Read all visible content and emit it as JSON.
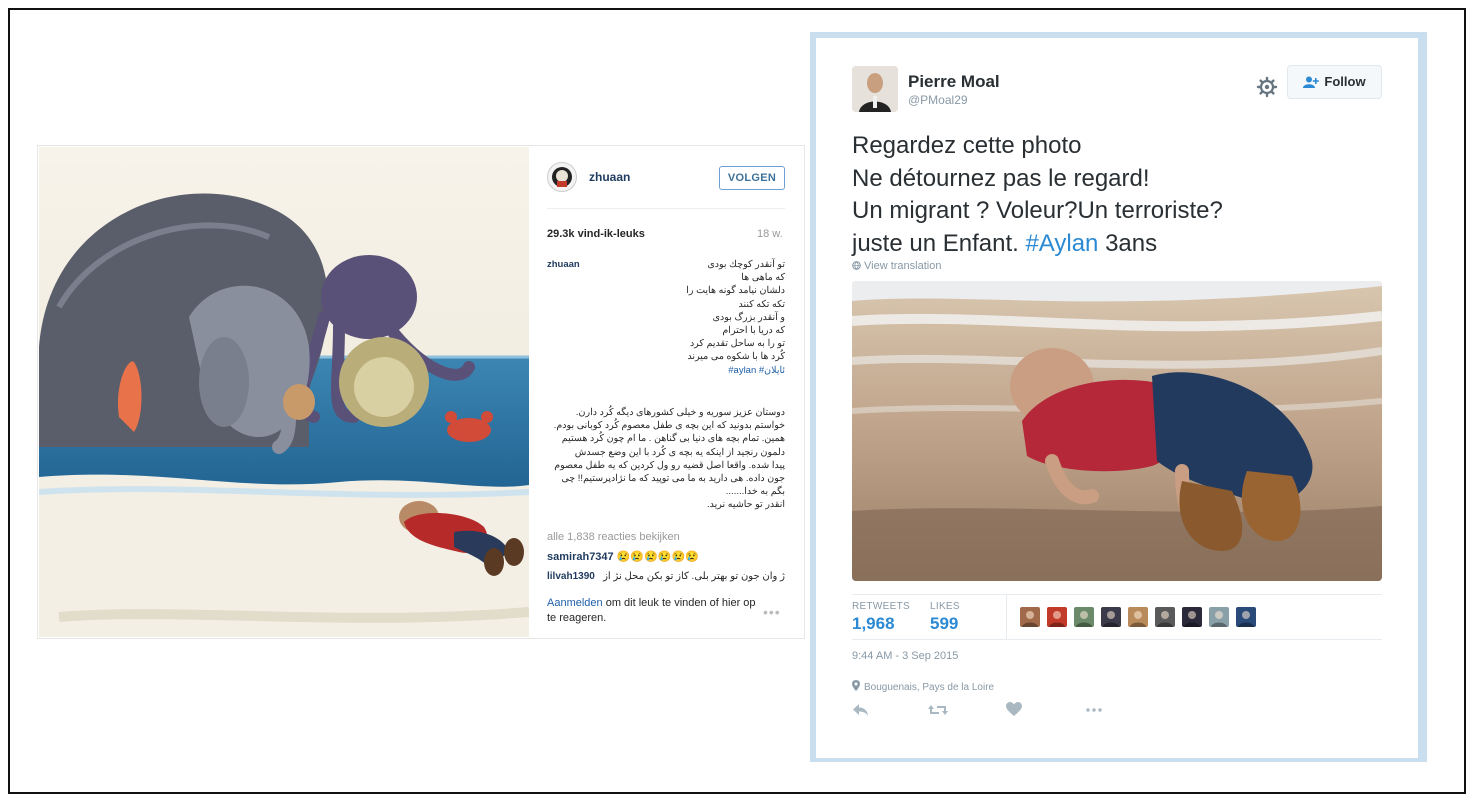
{
  "instagram": {
    "username": "zhuaan",
    "follow_label": "VOLGEN",
    "likes": "29.3k vind-ik-leuks",
    "time_ago": "18 w.",
    "caption_user": "zhuaan",
    "caption_lines": [
      "تو آنقدر کوچك بودی",
      "که ماهی ها",
      "دلشان نیامد گونه هایت را",
      "تکه تکه کنند",
      "و آنقدر بزرگ بودی",
      "که دریا با احترام",
      "تو را به ساحل تقدیم کرد",
      "کُرد ها با شکوه می میرند"
    ],
    "hashtags": "#aylan #ئايلان",
    "body_lines": [
      "دوستان عزیز سوریه و خیلی کشورهای دیگه کُرد دارن.",
      "خواستم بدونید که این بچه ی طفل معصوم کُرد کوبانی بودم.",
      "همین. تمام بچه های دنیا بی گناهن . ما ام چون کُرد هستیم",
      "دلمون رنجید از اینکه یه بچه ی کُرد با این وضع جسدش",
      "پیدا شده. واقعا اصل قضیه رو ول کردین که یه طفل معصوم",
      "جون داده. هی داريد به ما می توپيد كه ما نژادپرستيم!! چی",
      "بگم به خدا.......",
      "انقدر تو حاشیه نرید."
    ],
    "all_comments": "alle 1,838 reacties bekijken",
    "comment1_user": "samirah7347",
    "comment1_text": "😢😢😢😢😢😢",
    "comment2_user": "lilvah1390",
    "comment2_text": "ژ وان جون تو بهتر بلی. کاز تو بکن محل نژ از",
    "login_link": "Aanmelden",
    "login_text": " om dit leuk te vinden of hier op te reageren.",
    "more_label": "•••"
  },
  "twitter": {
    "name": "Pierre Moal",
    "handle": "@PMoal29",
    "follow_label": "Follow",
    "line1": "Regardez cette photo",
    "line2": "Ne détournez pas le regard!",
    "line3": "Un migrant ? Voleur?Un terroriste?",
    "line4_pre": "juste un Enfant. ",
    "line4_tag": "#Aylan",
    "line4_post": " 3ans",
    "view_translation": "View translation",
    "retweets_label": "RETWEETS",
    "retweets_value": "1,968",
    "likes_label": "LIKES",
    "likes_value": "599",
    "timestamp": "9:44 AM - 3 Sep 2015",
    "location": "Bouguenais, Pays de la Loire",
    "face_colors": [
      "#a06a4a",
      "#c23a2a",
      "#6a8a6a",
      "#3a3a4a",
      "#b98a5a",
      "#5a5a5a",
      "#2a2a3a",
      "#8aa0a8",
      "#2a4a7a"
    ]
  }
}
